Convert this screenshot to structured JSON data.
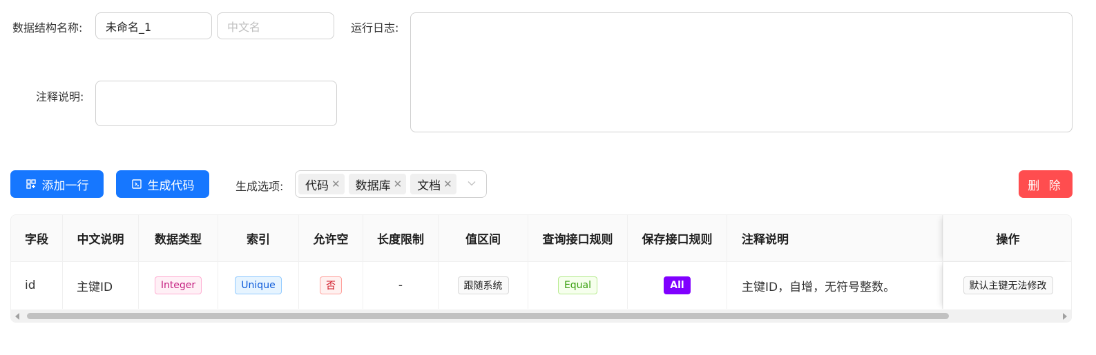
{
  "form": {
    "name_label": "数据结构名称:",
    "name_value": "未命名_1",
    "cn_placeholder": "中文名",
    "comment_label": "注释说明:",
    "log_label": "运行日志:"
  },
  "toolbar": {
    "add_row_label": "添加一行",
    "generate_code_label": "生成代码",
    "options_label": "生成选项:",
    "options": [
      {
        "label": "代码"
      },
      {
        "label": "数据库"
      },
      {
        "label": "文档"
      }
    ],
    "delete_label": "删 除"
  },
  "table": {
    "headers": [
      "字段",
      "中文说明",
      "数据类型",
      "索引",
      "允许空",
      "长度限制",
      "值区间",
      "查询接口规则",
      "保存接口规则",
      "注释说明",
      "操作"
    ],
    "rows": [
      {
        "field": "id",
        "cn": "主键ID",
        "type": "Integer",
        "index": "Unique",
        "nullable": "否",
        "length": "-",
        "range": "跟随系统",
        "query_rule": "Equal",
        "save_rule": "All",
        "comment": "主键ID，自增，无符号整数。",
        "action": "默认主键无法修改"
      }
    ]
  },
  "colors": {
    "primary": "#1677ff",
    "danger": "#ff4d4f",
    "purple_tag": "#8000ff"
  }
}
